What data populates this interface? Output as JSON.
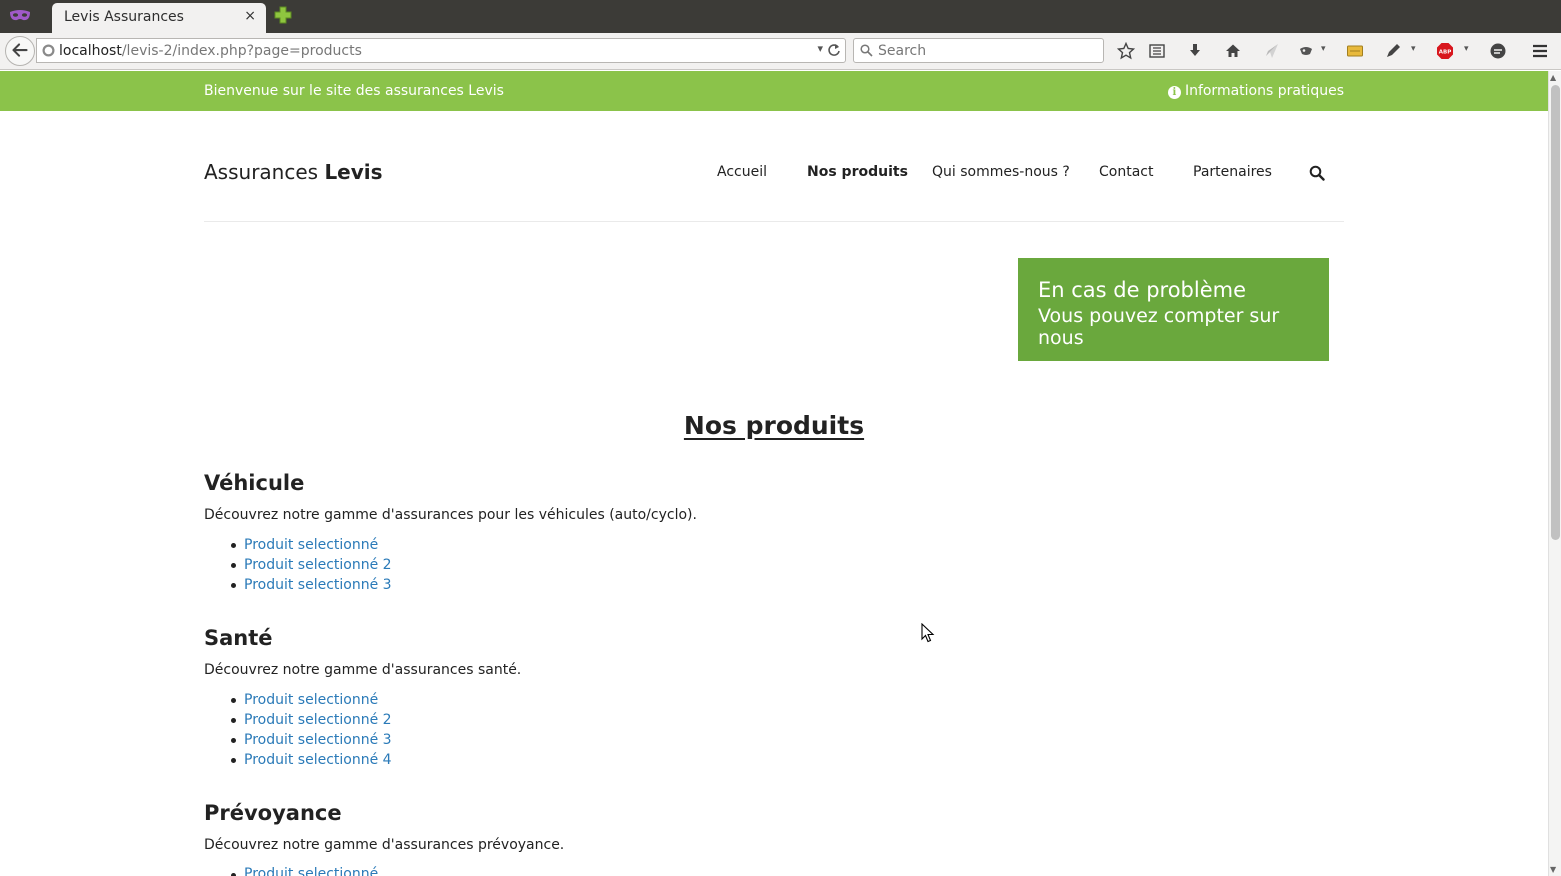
{
  "browser": {
    "tab_title": "Levis Assurances",
    "tab_close": "×",
    "url_host": "localhost",
    "url_path": "/levis-2/index.php?page=products",
    "search_placeholder": "Search",
    "url_dropdown": "▾",
    "drop_arrow": "▾",
    "toolbar_icons": [
      "star-icon",
      "reading-list-icon",
      "download-icon",
      "home-icon",
      "send-icon",
      "extension-icon",
      "notes-icon",
      "pen-icon",
      "adblock-icon",
      "chat-icon",
      "menu-icon"
    ],
    "adblock_label": "ABP"
  },
  "site": {
    "topbar": {
      "welcome": "Bienvenue sur le site des assurances Levis",
      "infos": "Informations pratiques",
      "info_icon": "i",
      "color": "#8bc34a"
    },
    "brand": {
      "light": "Assurances",
      "bold": "Levis"
    },
    "nav": [
      "Accueil",
      "Nos produits",
      "Qui sommes-nous ?",
      "Contact",
      "Partenaires"
    ],
    "nav_active": "Nos produits",
    "promo": {
      "title": "En cas de problème",
      "subtitle": "Vous pouvez compter sur nous",
      "color": "#6aa83d"
    },
    "page_title": "Nos produits",
    "sections": [
      {
        "title": "Véhicule",
        "description": "Découvrez notre gamme d'assurances pour les véhicules (auto/cyclo).",
        "products": [
          "Produit selectionné",
          "Produit selectionné 2",
          "Produit selectionné 3"
        ]
      },
      {
        "title": "Santé",
        "description": "Découvrez notre gamme d'assurances santé.",
        "products": [
          "Produit selectionné",
          "Produit selectionné 2",
          "Produit selectionné 3",
          "Produit selectionné 4"
        ]
      },
      {
        "title": "Prévoyance",
        "description": "Découvrez notre gamme d'assurances prévoyance.",
        "products": [
          "Produit selectionné"
        ]
      }
    ],
    "link_color": "#2a7ab8"
  },
  "scrollbar": {
    "up_arrow": "▲",
    "down_arrow": "▼"
  }
}
